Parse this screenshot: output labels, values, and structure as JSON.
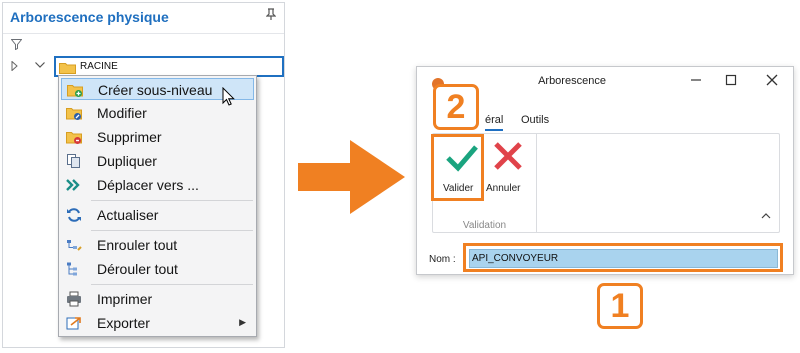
{
  "tree_panel": {
    "title": "Arborescence physique",
    "pin_icon": "pin-icon",
    "root_node": "RACINE"
  },
  "context_menu": {
    "items": [
      {
        "label": "Créer sous-niveau",
        "icon": "folder-add-icon"
      },
      {
        "label": "Modifier",
        "icon": "folder-edit-icon"
      },
      {
        "label": "Supprimer",
        "icon": "folder-delete-icon"
      },
      {
        "label": "Dupliquer",
        "icon": "duplicate-icon"
      },
      {
        "label": "Déplacer vers ...",
        "icon": "move-icon"
      },
      {
        "label": "Actualiser",
        "icon": "refresh-icon"
      },
      {
        "label": "Enrouler tout",
        "icon": "collapse-all-icon"
      },
      {
        "label": "Dérouler tout",
        "icon": "expand-all-icon"
      },
      {
        "label": "Imprimer",
        "icon": "printer-icon"
      },
      {
        "label": "Exporter",
        "icon": "export-icon"
      }
    ],
    "highlighted": "Créer sous-niveau"
  },
  "dialog": {
    "title": "Arborescence",
    "tabs": [
      {
        "label": "Général",
        "visible_text": "éral",
        "active": true
      },
      {
        "label": "Outils",
        "active": false
      }
    ],
    "ribbon": {
      "validate_label": "Valider",
      "cancel_label": "Annuler",
      "group_label": "Validation"
    },
    "name_label": "Nom :",
    "name_value": "API_CONVOYEUR"
  },
  "annotations": {
    "step1": "1",
    "step2": "2",
    "color": "#f08022"
  },
  "colors": {
    "accent_blue": "#1f6fbf",
    "menu_highlight": "#cfe5f8",
    "folder": "#f0b83a",
    "validate_green": "#1aa47f",
    "cancel_red": "#e0434a"
  }
}
